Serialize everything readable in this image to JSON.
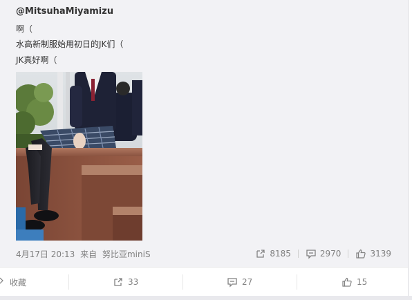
{
  "post": {
    "author": "@MitsuhaMiyamizu",
    "lines": [
      "啊（",
      "水高新制服始用初日的JK们（",
      "JK真好啊（"
    ]
  },
  "meta": {
    "date": "4月17日 20:13",
    "from_label": "来自",
    "source": "努比亚miniS",
    "repost_count": "8185",
    "comment_count": "2970",
    "like_count": "3139"
  },
  "actions": {
    "favorite_label": "收藏",
    "repost_count": "33",
    "comment_count": "27",
    "like_count": "15"
  },
  "colors": {
    "meta_text": "#808080",
    "panel_bg": "#f2f2f5",
    "body_text": "#333333"
  },
  "icons": {
    "repost": "share-out-icon",
    "comment": "comment-bubble-icon",
    "like": "thumbs-up-icon",
    "favorite": "star-icon"
  }
}
